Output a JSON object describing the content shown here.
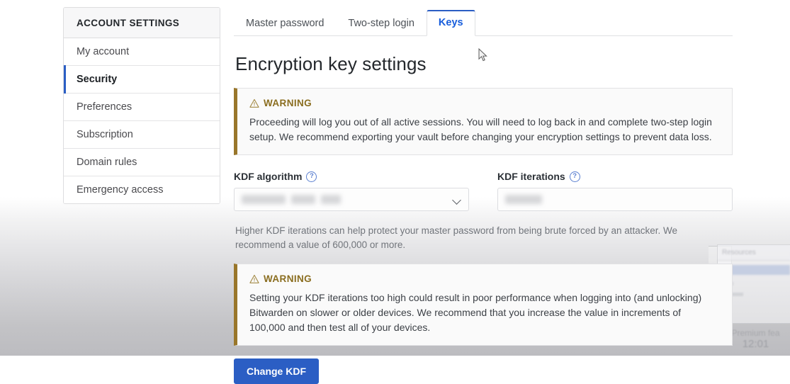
{
  "sidebar": {
    "header": "ACCOUNT SETTINGS",
    "items": [
      {
        "label": "My account",
        "active": false
      },
      {
        "label": "Security",
        "active": true
      },
      {
        "label": "Preferences",
        "active": false
      },
      {
        "label": "Subscription",
        "active": false
      },
      {
        "label": "Domain rules",
        "active": false
      },
      {
        "label": "Emergency access",
        "active": false
      }
    ]
  },
  "tabs": [
    {
      "label": "Master password",
      "active": false
    },
    {
      "label": "Two-step login",
      "active": false
    },
    {
      "label": "Keys",
      "active": true
    }
  ],
  "main": {
    "title": "Encryption key settings",
    "warning_1": {
      "icon": "warning-triangle-icon",
      "title": "WARNING",
      "body": "Proceeding will log you out of all active sessions. You will need to log back in and complete two-step login setup. We recommend exporting your vault before changing your encryption settings to prevent data loss."
    },
    "kdf_algorithm": {
      "label": "KDF algorithm",
      "help_icon": "help-circle-icon",
      "help_glyph": "?",
      "value": "",
      "redacted": true
    },
    "kdf_iterations": {
      "label": "KDF iterations",
      "help_icon": "help-circle-icon",
      "help_glyph": "?",
      "value": "",
      "redacted": true
    },
    "helper_text": "Higher KDF iterations can help protect your master password from being brute forced by an attacker. We recommend a value of 600,000 or more.",
    "warning_2": {
      "icon": "warning-triangle-icon",
      "title": "WARNING",
      "body": "Setting your KDF iterations too high could result in poor performance when logging into (and unlocking) Bitwarden on slower or older devices. We recommend that you increase the value in increments of 100,000 and then test all of your devices."
    },
    "change_kdf_button": "Change KDF"
  },
  "ghost_overlay": {
    "titlebar_text": "Resources",
    "footer_text": "Premium fea",
    "clock_text": "12:01"
  },
  "colors": {
    "accent_blue": "#2b5ec4",
    "tab_active_blue": "#175ddc",
    "warning_gold": "#99762a",
    "warning_text": "#8a6d1f",
    "page_grey": "#bcbcc0"
  }
}
